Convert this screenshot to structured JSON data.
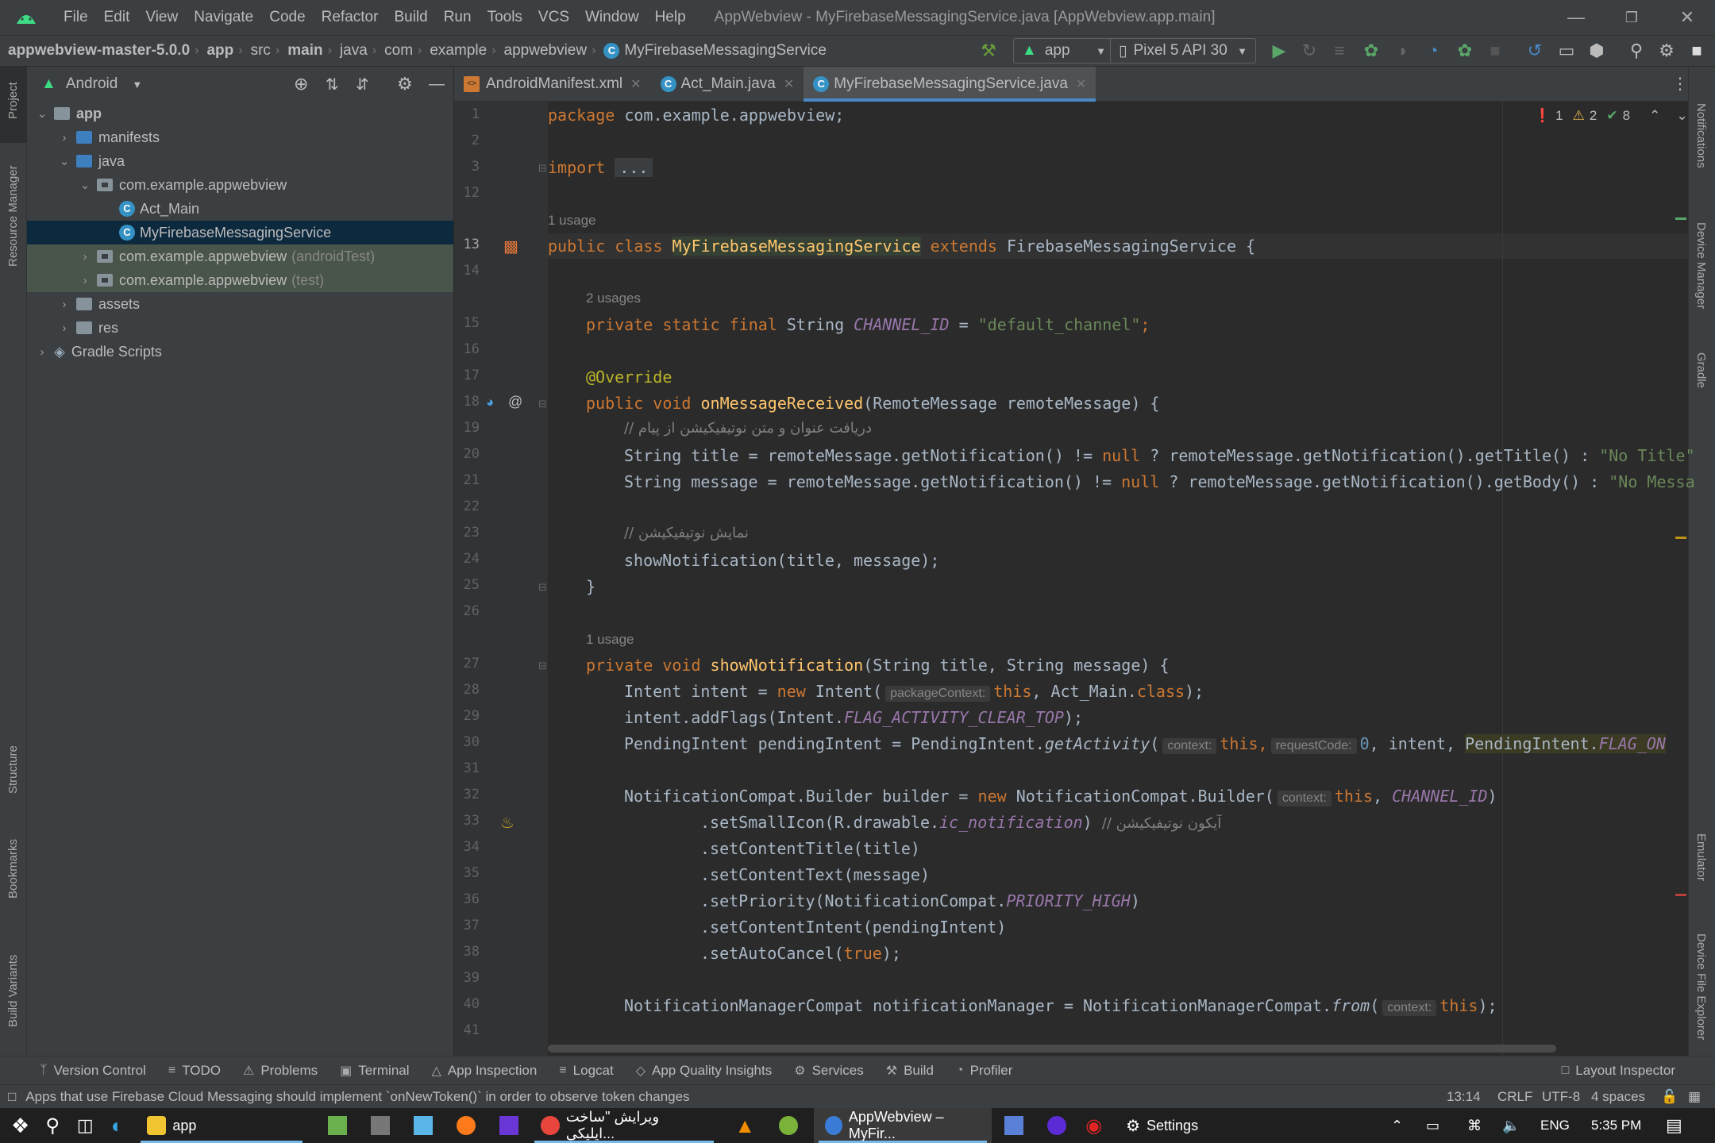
{
  "menubar": {
    "items": [
      "File",
      "Edit",
      "View",
      "Navigate",
      "Code",
      "Refactor",
      "Build",
      "Run",
      "Tools",
      "VCS",
      "Window",
      "Help"
    ],
    "title": "AppWebview - MyFirebaseMessagingService.java [AppWebview.app.main]"
  },
  "breadcrumb": [
    "appwebview-master-5.0.0",
    "app",
    "src",
    "main",
    "java",
    "com",
    "example",
    "appwebview",
    "MyFirebaseMessagingService"
  ],
  "toolbar": {
    "run_config": "app",
    "device": "Pixel 5 API 30"
  },
  "project": {
    "view_mode": "Android",
    "tree": [
      {
        "label": "app",
        "bold": true
      },
      {
        "label": "manifests"
      },
      {
        "label": "java"
      },
      {
        "label": "com.example.appwebview"
      },
      {
        "label": "Act_Main"
      },
      {
        "label": "MyFirebaseMessagingService"
      },
      {
        "label": "com.example.appwebview",
        "suffix": "(androidTest)"
      },
      {
        "label": "com.example.appwebview",
        "suffix": "(test)"
      },
      {
        "label": "assets"
      },
      {
        "label": "res"
      },
      {
        "label": "Gradle Scripts"
      }
    ]
  },
  "left_tools": [
    "Project",
    "Resource Manager",
    "Structure",
    "Bookmarks",
    "Build Variants"
  ],
  "right_tools": [
    "Notifications",
    "Device Manager",
    "Gradle",
    "Emulator",
    "Device File Explorer"
  ],
  "tabs": [
    "AndroidManifest.xml",
    "Act_Main.java",
    "MyFirebaseMessagingService.java"
  ],
  "inspections": {
    "errors": "1",
    "warnings": "2",
    "ok": "8"
  },
  "code": {
    "line_numbers": [
      "1",
      "2",
      "3",
      "12",
      "",
      "13",
      "14",
      "",
      "15",
      "16",
      "17",
      "18",
      "19",
      "20",
      "21",
      "22",
      "23",
      "24",
      "25",
      "26",
      "",
      "27",
      "28",
      "29",
      "30",
      "31",
      "32",
      "33",
      "34",
      "35",
      "36",
      "37",
      "38",
      "39",
      "40",
      "41"
    ],
    "usage_1": "1 usage",
    "usage_2": "2 usages",
    "usage_3": "1 usage",
    "l1_kw": "package",
    "l1_rest": " com.example.appwebview;",
    "l3_kw": "import",
    "l3_fold": "...",
    "l13_kw1": "public class ",
    "l13_cls": "MyFirebaseMessagingService",
    "l13_kw2": " extends ",
    "l13_rest": "FirebaseMessagingService {",
    "l15_kw": "private static final ",
    "l15_type": "String ",
    "l15_const": "CHANNEL_ID",
    "l15_eq": " = ",
    "l15_str": "\"default_channel\"",
    "l15_end": ";",
    "l17_an": "@Override",
    "l18_kw": "public void ",
    "l18_fn": "onMessageReceived",
    "l18_rest": "(RemoteMessage remoteMessage) {",
    "l19_cm": "// دریافت عنوان و متن نوتیفیکیشن از پیام",
    "l20_a": "String title = remoteMessage.getNotification() != ",
    "l20_kw": "null",
    "l20_b": " ? remoteMessage.getNotification().getTitle() : ",
    "l20_str": "\"No Title\"",
    "l21_a": "String message = remoteMessage.getNotification() != ",
    "l21_kw": "null",
    "l21_b": " ? remoteMessage.getNotification().getBody() : ",
    "l21_str": "\"No Messa",
    "l23_cm": "// نمایش نوتیفیکیشن",
    "l24": "showNotification(title, message);",
    "l25": "}",
    "l27_kw": "private void ",
    "l27_fn": "showNotification",
    "l27_rest": "(String title, String message) {",
    "l28_a": "Intent intent = ",
    "l28_kw": "new ",
    "l28_b": "Intent(",
    "l28_hint": "packageContext:",
    "l28_this": "this",
    "l28_c": ", Act_Main.",
    "l28_cls": "class",
    "l28_d": ");",
    "l29_a": "intent.addFlags(Intent.",
    "l29_const": "FLAG_ACTIVITY_CLEAR_TOP",
    "l29_b": ");",
    "l30_a": "PendingIntent pendingIntent = PendingIntent.",
    "l30_fn": "getActivity",
    "l30_b": "(",
    "l30_hint1": "context:",
    "l30_this": "this",
    "l30_c": ",",
    "l30_hint2": "requestCode:",
    "l30_num": "0",
    "l30_d": ", intent, ",
    "l30_e": "PendingIntent.",
    "l30_const": "FLAG_ON",
    "l32_a": "NotificationCompat.Builder builder = ",
    "l32_kw": "new ",
    "l32_b": "NotificationCompat.Builder(",
    "l32_hint": "context:",
    "l32_this": "this",
    "l32_c": ", ",
    "l32_const": "CHANNEL_ID",
    "l32_d": ")",
    "l33_a": ".setSmallIcon(R.drawable.",
    "l33_const": "ic_notification",
    "l33_b": ") ",
    "l33_cm": "// آیکون نوتیفیکیشن",
    "l34": ".setContentTitle(title)",
    "l35": ".setContentText(message)",
    "l36_a": ".setPriority(NotificationCompat.",
    "l36_const": "PRIORITY_HIGH",
    "l36_b": ")",
    "l37": ".setContentIntent(pendingIntent)",
    "l38_a": ".setAutoCancel(",
    "l38_kw": "true",
    "l38_b": ");",
    "l40_a": "NotificationManagerCompat notificationManager = NotificationManagerCompat.",
    "l40_fn": "from",
    "l40_b": "(",
    "l40_hint": "context:",
    "l40_this": "this",
    "l40_c": ");"
  },
  "bottom_tools": [
    "Version Control",
    "TODO",
    "Problems",
    "Terminal",
    "App Inspection",
    "Logcat",
    "App Quality Insights",
    "Services",
    "Build",
    "Profiler",
    "Layout Inspector"
  ],
  "status": {
    "message": "Apps that use Firebase Cloud Messaging should implement `onNewToken()` in order to observe token changes",
    "position": "13:14",
    "line_sep": "CRLF",
    "encoding": "UTF-8",
    "indent": "4 spaces"
  },
  "taskbar": {
    "items": [
      "app",
      "ویرایش \"ساخت اپلیکی...",
      "AppWebview – MyFir...",
      "Settings"
    ],
    "lang": "ENG",
    "time": "5:35 PM"
  },
  "colors": {
    "accent": "#4a88c7",
    "keyword": "#cc7832",
    "string": "#6a8759",
    "function": "#ffc66d",
    "constant": "#9876aa"
  }
}
